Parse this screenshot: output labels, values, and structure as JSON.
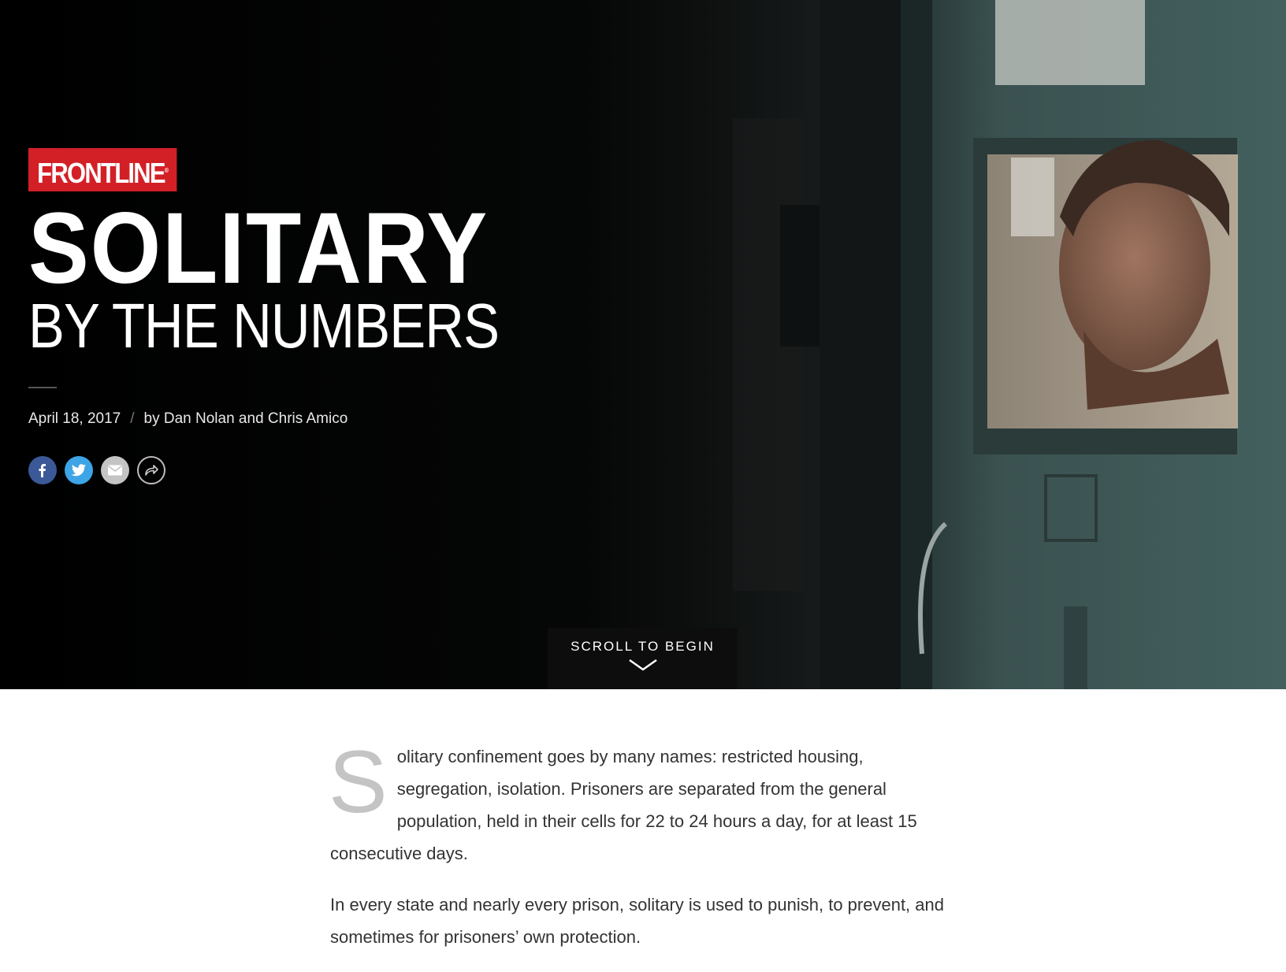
{
  "brand": {
    "logo_text": "FRONTLINE",
    "logo_mark": "®",
    "logo_color": "#d32027"
  },
  "headline": {
    "main": "SOLITARY",
    "sub": "BY THE NUMBERS"
  },
  "meta": {
    "date": "April 18, 2017",
    "separator": "/",
    "byline": "by Dan Nolan and Chris Amico"
  },
  "share": [
    {
      "name": "facebook",
      "icon": "facebook-icon",
      "color": "#3b5998"
    },
    {
      "name": "twitter",
      "icon": "twitter-icon",
      "color": "#3da5e6"
    },
    {
      "name": "email",
      "icon": "mail-icon",
      "color": "#c4c4c4"
    },
    {
      "name": "share",
      "icon": "share-arrow-icon",
      "color": "#bdbdbd"
    }
  ],
  "scroll_prompt": {
    "label": "SCROLL TO BEGIN",
    "icon": "chevron-down-icon"
  },
  "article": {
    "dropcap": "S",
    "para1_rest": "olitary confinement goes by many names: restricted housing, segregation, isolation. Prisoners are separated from the general population, held in their cells for 22 to 24 hours a day, for at least 15 consecutive days.",
    "para2": "In every state and nearly every prison, solitary is used to punish, to prevent, and sometimes for prisoners’ own protection."
  }
}
